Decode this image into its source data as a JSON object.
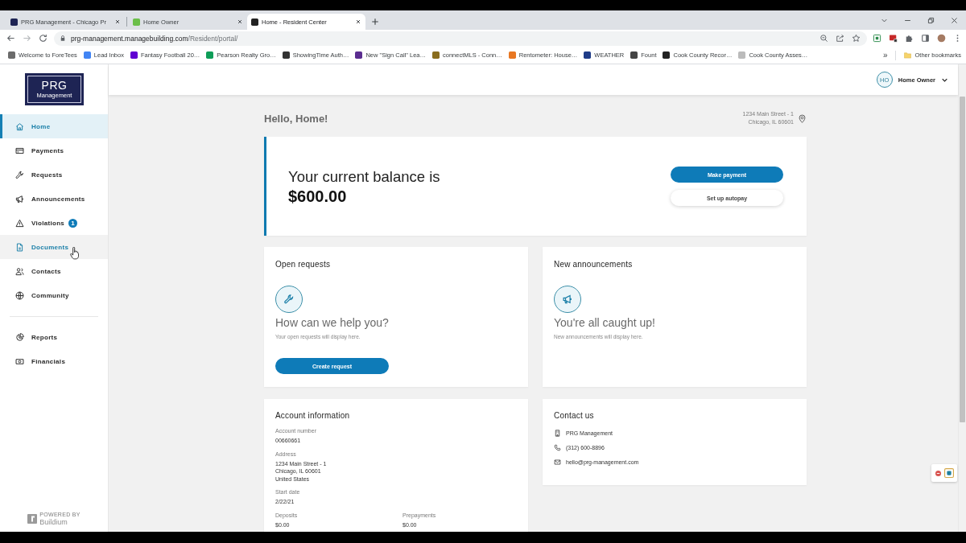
{
  "browser": {
    "tabs": [
      {
        "title": "PRG Management - Chicago Pr",
        "selected": false,
        "color": "#1e2454"
      },
      {
        "title": "Home Owner",
        "selected": false,
        "color": "#6cbf4a"
      },
      {
        "title": "Home - Resident Center",
        "selected": true,
        "color": "#222222"
      }
    ],
    "url_host": "prg-management.managebuilding.com",
    "url_path": "/Resident/portal/",
    "bookmarks": [
      {
        "label": "Welcome to ForeTees",
        "color": "#6b6b6b"
      },
      {
        "label": "Lead Inbox",
        "color": "#4285f4"
      },
      {
        "label": "Fantasy Football 20…",
        "color": "#6001d2"
      },
      {
        "label": "Pearson Realty Gro…",
        "color": "#0f9d58"
      },
      {
        "label": "ShowingTime Auth…",
        "color": "#333333"
      },
      {
        "label": "New \"Sign Call\" Lea…",
        "color": "#5b2d90"
      },
      {
        "label": "connectMLS - Conn…",
        "color": "#8a6d1e"
      },
      {
        "label": "Rentometer: House…",
        "color": "#e87722"
      },
      {
        "label": "WEATHER",
        "color": "#1f3c88"
      },
      {
        "label": "Fount",
        "color": "#444444"
      },
      {
        "label": "Cook County Recor…",
        "color": "#222222"
      },
      {
        "label": "Cook County Asses…",
        "color": "#bbbbbb"
      }
    ],
    "more_bookmarks": "»",
    "other_bookmarks": "Other bookmarks"
  },
  "sidebar": {
    "logo_title": "PRG",
    "logo_subtitle": "Management",
    "items": [
      {
        "label": "Home",
        "selected": true,
        "hovered": false
      },
      {
        "label": "Payments",
        "selected": false,
        "hovered": false
      },
      {
        "label": "Requests",
        "selected": false,
        "hovered": false
      },
      {
        "label": "Announcements",
        "selected": false,
        "hovered": false
      },
      {
        "label": "Violations",
        "selected": false,
        "hovered": false,
        "badge": "1"
      },
      {
        "label": "Documents",
        "selected": false,
        "hovered": true
      },
      {
        "label": "Contacts",
        "selected": false,
        "hovered": false
      },
      {
        "label": "Community",
        "selected": false,
        "hovered": false
      }
    ],
    "secondary_items": [
      {
        "label": "Reports",
        "selected": false,
        "hovered": false
      },
      {
        "label": "Financials",
        "selected": false,
        "hovered": false
      }
    ],
    "powered_by": "POWERED BY",
    "vendor": "Buildium"
  },
  "header": {
    "avatar_initials": "HO",
    "user_name": "Home Owner"
  },
  "main": {
    "greeting": "Hello, Home!",
    "address_lines": [
      "1234 Main Street - 1",
      "Chicago, IL 60601"
    ],
    "balance": {
      "label": "Your current balance is",
      "amount": "$600.00",
      "buttons": [
        {
          "label": "Make payment",
          "kind": "primary"
        },
        {
          "label": "Set up autopay",
          "kind": "secondary"
        }
      ]
    },
    "requests": {
      "title": "Open requests",
      "heading": "How can we help you?",
      "text": "Your open requests will display here.",
      "button": "Create request"
    },
    "announcements": {
      "title": "New announcements",
      "heading": "You're all caught up!",
      "text": "New announcements will display here."
    },
    "account": {
      "title": "Account information",
      "fields": [
        {
          "label": "Account number",
          "lines": [
            "00660661"
          ]
        },
        {
          "label": "Address",
          "lines": [
            "1234 Main Street - 1",
            "Chicago, IL 60601",
            "United States"
          ]
        },
        {
          "label": "Start date",
          "lines": [
            "2/22/21"
          ]
        }
      ],
      "columns": [
        {
          "label": "Deposits",
          "value": "$0.00"
        },
        {
          "label": "Prepayments",
          "value": "$0.00"
        }
      ]
    },
    "contact": {
      "title": "Contact us",
      "items": [
        "PRG Management",
        "(312) 600-8896",
        "hello@prg-management.com"
      ]
    }
  }
}
